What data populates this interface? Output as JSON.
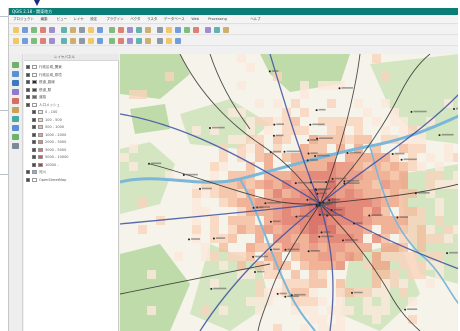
{
  "window": {
    "title": "QGIS 2.18 - 関東地方"
  },
  "menubar": {
    "items": [
      "プロジェクト",
      "編集",
      "ビュー",
      "レイヤ",
      "設定",
      "プラグイン",
      "ベクタ",
      "ラスタ",
      "データベース",
      "Web",
      "Processing",
      "ヘルプ"
    ]
  },
  "toolbars": {
    "row1_icons": [
      "new-project",
      "open-project",
      "save-project",
      "save-as",
      "print-composer",
      "pan",
      "pan-to-selection",
      "zoom-in",
      "zoom-out",
      "zoom-full",
      "zoom-layer",
      "zoom-selection",
      "zoom-last",
      "zoom-next",
      "refresh",
      "identify",
      "select",
      "deselect",
      "measure",
      "statistics",
      "attribute-table",
      "label",
      "help"
    ],
    "row2_icons": [
      "digitize",
      "edit",
      "save-edits",
      "add-feature",
      "move-feature",
      "node-tool",
      "delete-selected",
      "cut",
      "copy",
      "paste",
      "undo",
      "redo",
      "label-tool",
      "pin-labels",
      "show-labels",
      "move-label",
      "rotate-label",
      "change-label"
    ]
  },
  "leftbar": {
    "icons": [
      "add-vector-layer",
      "add-raster-layer",
      "add-postgis-layer",
      "add-spatialite-layer",
      "add-mssql-layer",
      "add-oracle-layer",
      "add-wms-layer",
      "add-wcs-layer",
      "add-wfs-layer",
      "add-delimited-text-layer"
    ]
  },
  "layers_panel": {
    "title": "レイヤパネル",
    "layers": [
      {
        "label": "行政区域_関東",
        "checked": true,
        "swatch": "#ffffff"
      },
      {
        "label": "行政区域_県境",
        "checked": true,
        "swatch": "#ffffff"
      },
      {
        "label": "鉄道_路線",
        "checked": true,
        "swatch": "#2b2b2b"
      },
      {
        "label": "鉄道_駅",
        "checked": true,
        "swatch": "#444444"
      },
      {
        "label": "道路",
        "checked": true,
        "swatch": "#666666"
      },
      {
        "label": "人口メッシュ",
        "checked": true,
        "swatch": "#ffffff"
      },
      {
        "label": "0 - 100",
        "checked": true,
        "swatch": "#fde9dc"
      },
      {
        "label": "100 - 500",
        "checked": true,
        "swatch": "#f9d3bb"
      },
      {
        "label": "500 - 1000",
        "checked": true,
        "swatch": "#f5bd9d"
      },
      {
        "label": "1000 - 2000",
        "checked": true,
        "swatch": "#f0a283"
      },
      {
        "label": "2000 - 3000",
        "checked": true,
        "swatch": "#e98870"
      },
      {
        "label": "3000 - 5000",
        "checked": true,
        "swatch": "#e06f5e"
      },
      {
        "label": "5000 - 10000",
        "checked": true,
        "swatch": "#d2574d"
      },
      {
        "label": "10000 -",
        "checked": true,
        "swatch": "#bf3e3d"
      },
      {
        "label": "河川",
        "checked": true,
        "swatch": "#7bb7d8"
      },
      {
        "label": "OpenStreetMap",
        "checked": true,
        "swatch": "#ffffff"
      }
    ]
  },
  "map": {
    "background": "#f6f3ea",
    "forest_color": "#cfe3bd",
    "forest_dark_color": "#b9d8a3",
    "river_color": "#7bb7d8",
    "road_color": "#2f2f2f",
    "main_road_color": "#3b4fa0",
    "density_colors": [
      "#fde9dc",
      "#f9d3bb",
      "#f5bd9d",
      "#f0a283",
      "#e98870",
      "#e06f5e",
      "#d2574d",
      "#bf3e3d"
    ]
  },
  "colors": {
    "titlebar": "#0a7d77",
    "cursor": "#1b2a7a"
  }
}
